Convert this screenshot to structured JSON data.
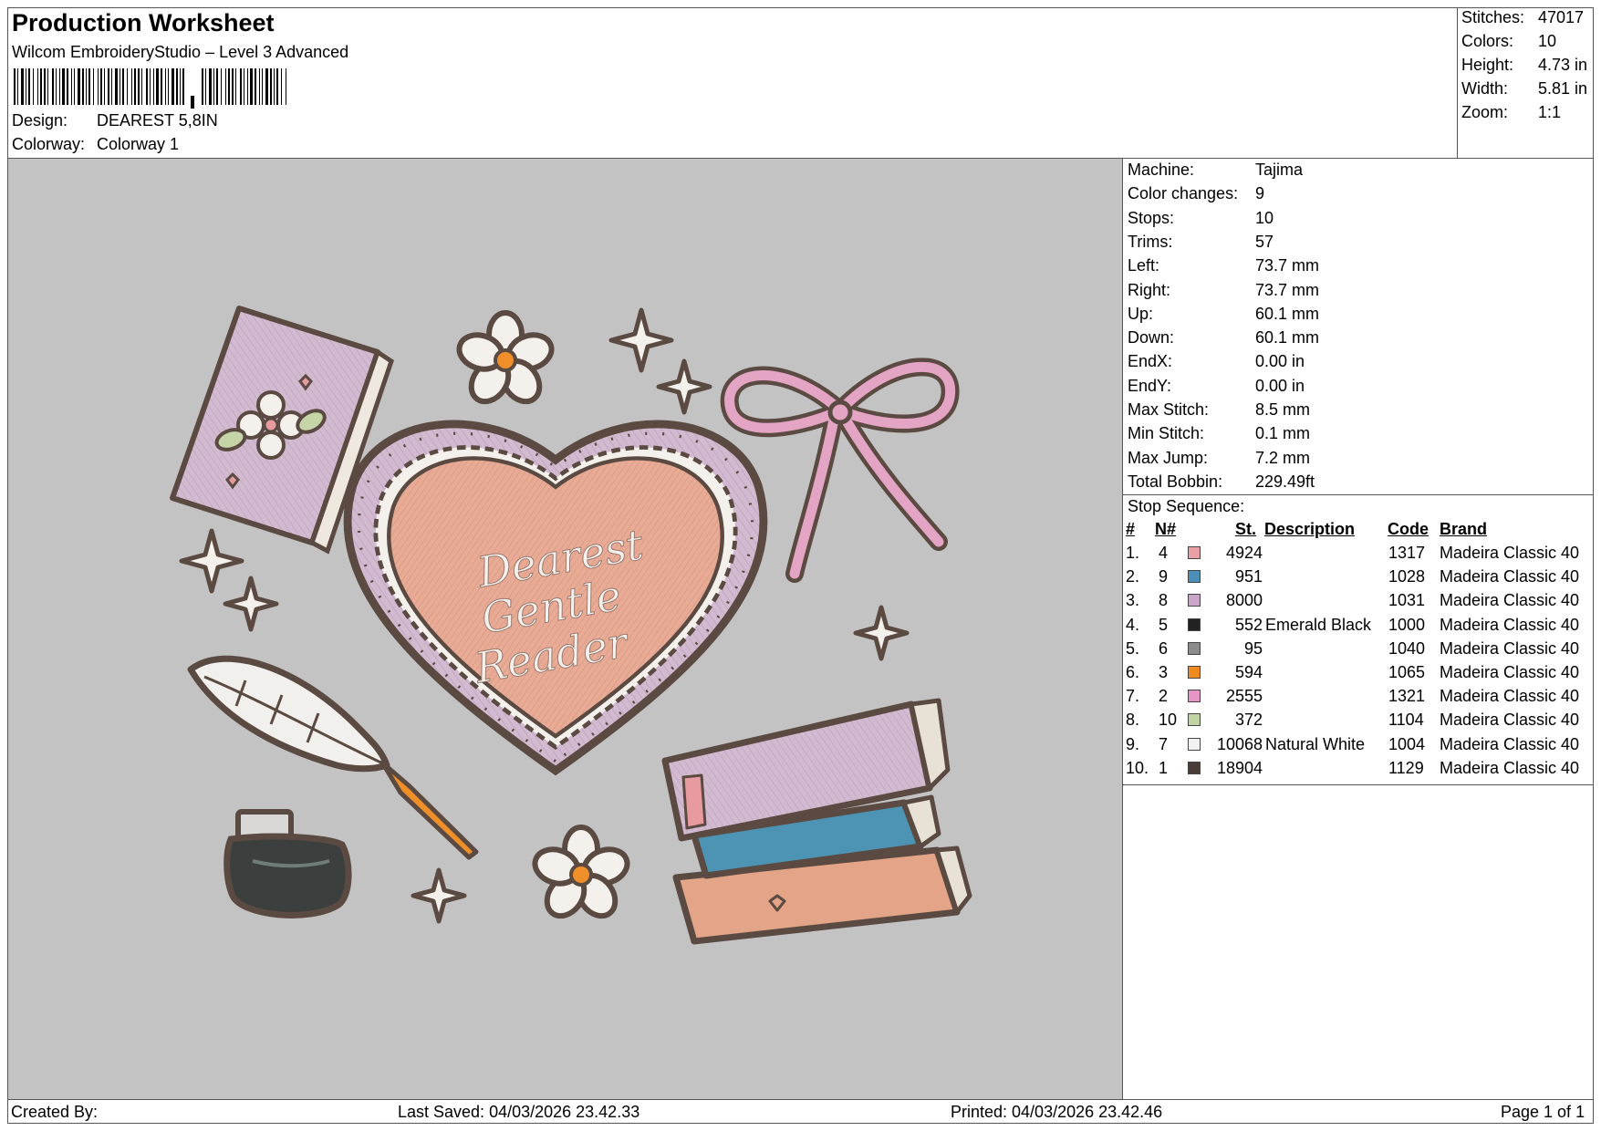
{
  "header": {
    "title": "Production Worksheet",
    "software": "Wilcom EmbroideryStudio – Level 3 Advanced",
    "design_label": "Design:",
    "design_value": "DEAREST 5,8IN",
    "colorway_label": "Colorway:",
    "colorway_value": "Colorway 1"
  },
  "summary": {
    "stitches_label": "Stitches:",
    "stitches_value": "47017",
    "colors_label": "Colors:",
    "colors_value": "10",
    "height_label": "Height:",
    "height_value": "4.73 in",
    "width_label": "Width:",
    "width_value": "5.81 in",
    "zoom_label": "Zoom:",
    "zoom_value": "1:1"
  },
  "machine_info": [
    {
      "label": "Machine:",
      "value": "Tajima"
    },
    {
      "label": "Color changes:",
      "value": "9"
    },
    {
      "label": "Stops:",
      "value": "10"
    },
    {
      "label": "Trims:",
      "value": "57"
    },
    {
      "label": "Left:",
      "value": "73.7 mm"
    },
    {
      "label": "Right:",
      "value": "73.7 mm"
    },
    {
      "label": "Up:",
      "value": "60.1 mm"
    },
    {
      "label": "Down:",
      "value": "60.1 mm"
    },
    {
      "label": "EndX:",
      "value": "0.00 in"
    },
    {
      "label": "EndY:",
      "value": "0.00 in"
    },
    {
      "label": "Max Stitch:",
      "value": "8.5 mm"
    },
    {
      "label": "Min Stitch:",
      "value": "0.1 mm"
    },
    {
      "label": "Max Jump:",
      "value": "7.2 mm"
    },
    {
      "label": "Total Bobbin:",
      "value": "229.49ft"
    }
  ],
  "stop_sequence": {
    "title": "Stop Sequence:",
    "headers": {
      "index": "#",
      "needle": "N#",
      "stitches": "St.",
      "description": "Description",
      "code": "Code",
      "brand": "Brand"
    },
    "rows": [
      {
        "index": "1.",
        "needle": "4",
        "color": "#e8a0a6",
        "stitches": "4924",
        "description": "",
        "code": "1317",
        "brand": "Madeira Classic 40"
      },
      {
        "index": "2.",
        "needle": "9",
        "color": "#4d8fb8",
        "stitches": "951",
        "description": "",
        "code": "1028",
        "brand": "Madeira Classic 40"
      },
      {
        "index": "3.",
        "needle": "8",
        "color": "#c9a6c8",
        "stitches": "8000",
        "description": "",
        "code": "1031",
        "brand": "Madeira Classic 40"
      },
      {
        "index": "4.",
        "needle": "5",
        "color": "#222222",
        "stitches": "552",
        "description": "Emerald Black",
        "code": "1000",
        "brand": "Madeira Classic 40"
      },
      {
        "index": "5.",
        "needle": "6",
        "color": "#8c8c8c",
        "stitches": "95",
        "description": "",
        "code": "1040",
        "brand": "Madeira Classic 40"
      },
      {
        "index": "6.",
        "needle": "3",
        "color": "#ee8a1e",
        "stitches": "594",
        "description": "",
        "code": "1065",
        "brand": "Madeira Classic 40"
      },
      {
        "index": "7.",
        "needle": "2",
        "color": "#e596c4",
        "stitches": "2555",
        "description": "",
        "code": "1321",
        "brand": "Madeira Classic 40"
      },
      {
        "index": "8.",
        "needle": "10",
        "color": "#bfd4a0",
        "stitches": "372",
        "description": "",
        "code": "1104",
        "brand": "Madeira Classic 40"
      },
      {
        "index": "9.",
        "needle": "7",
        "color": "#f2f2f2",
        "stitches": "10068",
        "description": "Natural White",
        "code": "1004",
        "brand": "Madeira Classic 40"
      },
      {
        "index": "10.",
        "needle": "1",
        "color": "#4a3d38",
        "stitches": "18904",
        "description": "",
        "code": "1129",
        "brand": "Madeira Classic 40"
      }
    ]
  },
  "design_preview": {
    "heart_text": [
      "Dearest",
      "Gentle",
      "Reader"
    ]
  },
  "footer": {
    "created_by": "Created By:",
    "last_saved": "Last Saved: 04/03/2026 23.42.33",
    "printed": "Printed: 04/03/2026 23.42.46",
    "page": "Page 1 of 1"
  }
}
